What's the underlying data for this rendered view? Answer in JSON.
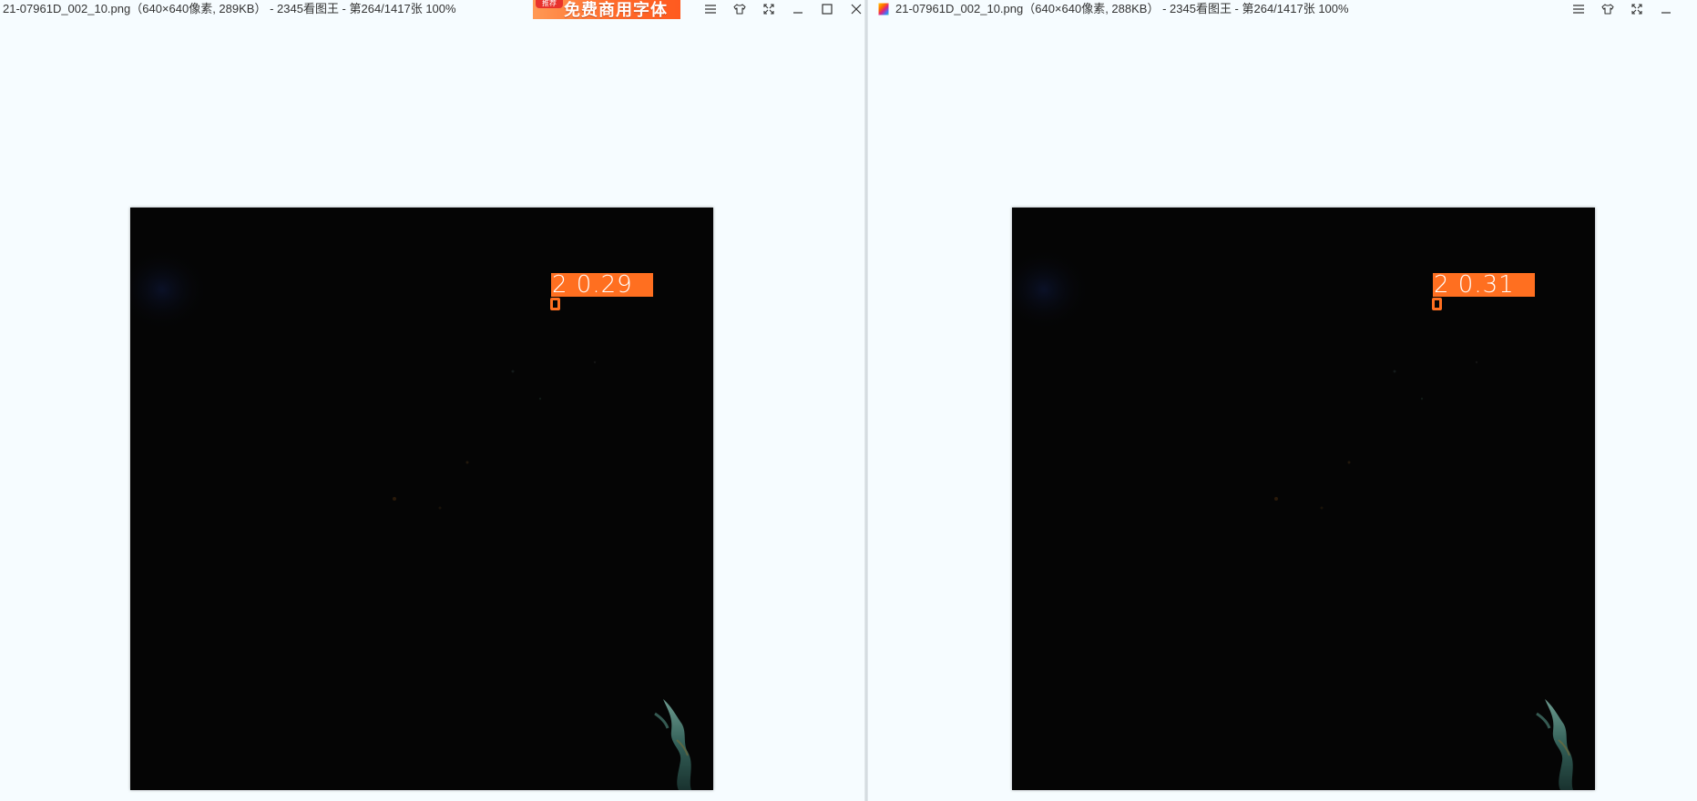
{
  "windows": [
    {
      "title": "21-07961D_002_10.png（640×640像素, 289KB） - 2345看图王 - 第264/1417张 100%",
      "ad": {
        "tag": "推荐",
        "text": "免费商用字体"
      },
      "detection": {
        "label": "2 0.29"
      },
      "controls": [
        "menu-icon",
        "skin-icon",
        "fullscreen-icon",
        "minimize-icon",
        "maximize-icon",
        "close-icon"
      ]
    },
    {
      "title": "21-07961D_002_10.png（640×640像素, 288KB） - 2345看图王 - 第264/1417张 100%",
      "detection": {
        "label": "2 0.31"
      },
      "controls": [
        "menu-icon",
        "skin-icon",
        "fullscreen-icon",
        "minimize-icon"
      ]
    }
  ],
  "colors": {
    "background": "#f6fcff",
    "detection": "#ff6f20",
    "image_bg": "#050505"
  }
}
